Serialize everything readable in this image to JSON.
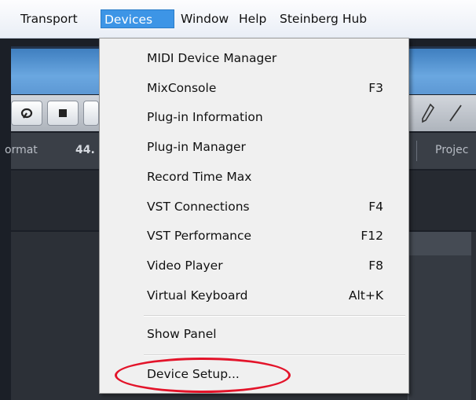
{
  "menubar": {
    "items": [
      {
        "label": "Transport"
      },
      {
        "label": "Devices"
      },
      {
        "label": "Window"
      },
      {
        "label": "Help"
      },
      {
        "label": "Steinberg Hub"
      }
    ]
  },
  "background": {
    "status_format_label": "ormat",
    "status_rate_label": "44.",
    "status_project_label": "Projec"
  },
  "toolbar": {
    "cycle_icon": "loop-icon",
    "stop_icon": "stop-icon",
    "edit_icons": [
      "pencil-icon",
      "line-icon"
    ]
  },
  "devices_menu": {
    "items": [
      {
        "label": "MIDI Device Manager",
        "shortcut": ""
      },
      {
        "label": "MixConsole",
        "shortcut": "F3"
      },
      {
        "label": "Plug-in Information",
        "shortcut": ""
      },
      {
        "label": "Plug-in Manager",
        "shortcut": ""
      },
      {
        "label": "Record Time Max",
        "shortcut": ""
      },
      {
        "label": "VST Connections",
        "shortcut": "F4"
      },
      {
        "label": "VST Performance",
        "shortcut": "F12"
      },
      {
        "label": "Video Player",
        "shortcut": "F8"
      },
      {
        "label": "Virtual Keyboard",
        "shortcut": "Alt+K"
      },
      {
        "label": "Show Panel",
        "shortcut": ""
      },
      {
        "label": "Device Setup...",
        "shortcut": ""
      }
    ]
  },
  "annotation": {
    "color": "#e3142a"
  },
  "colors": {
    "menu_active": "#3d95e6"
  }
}
